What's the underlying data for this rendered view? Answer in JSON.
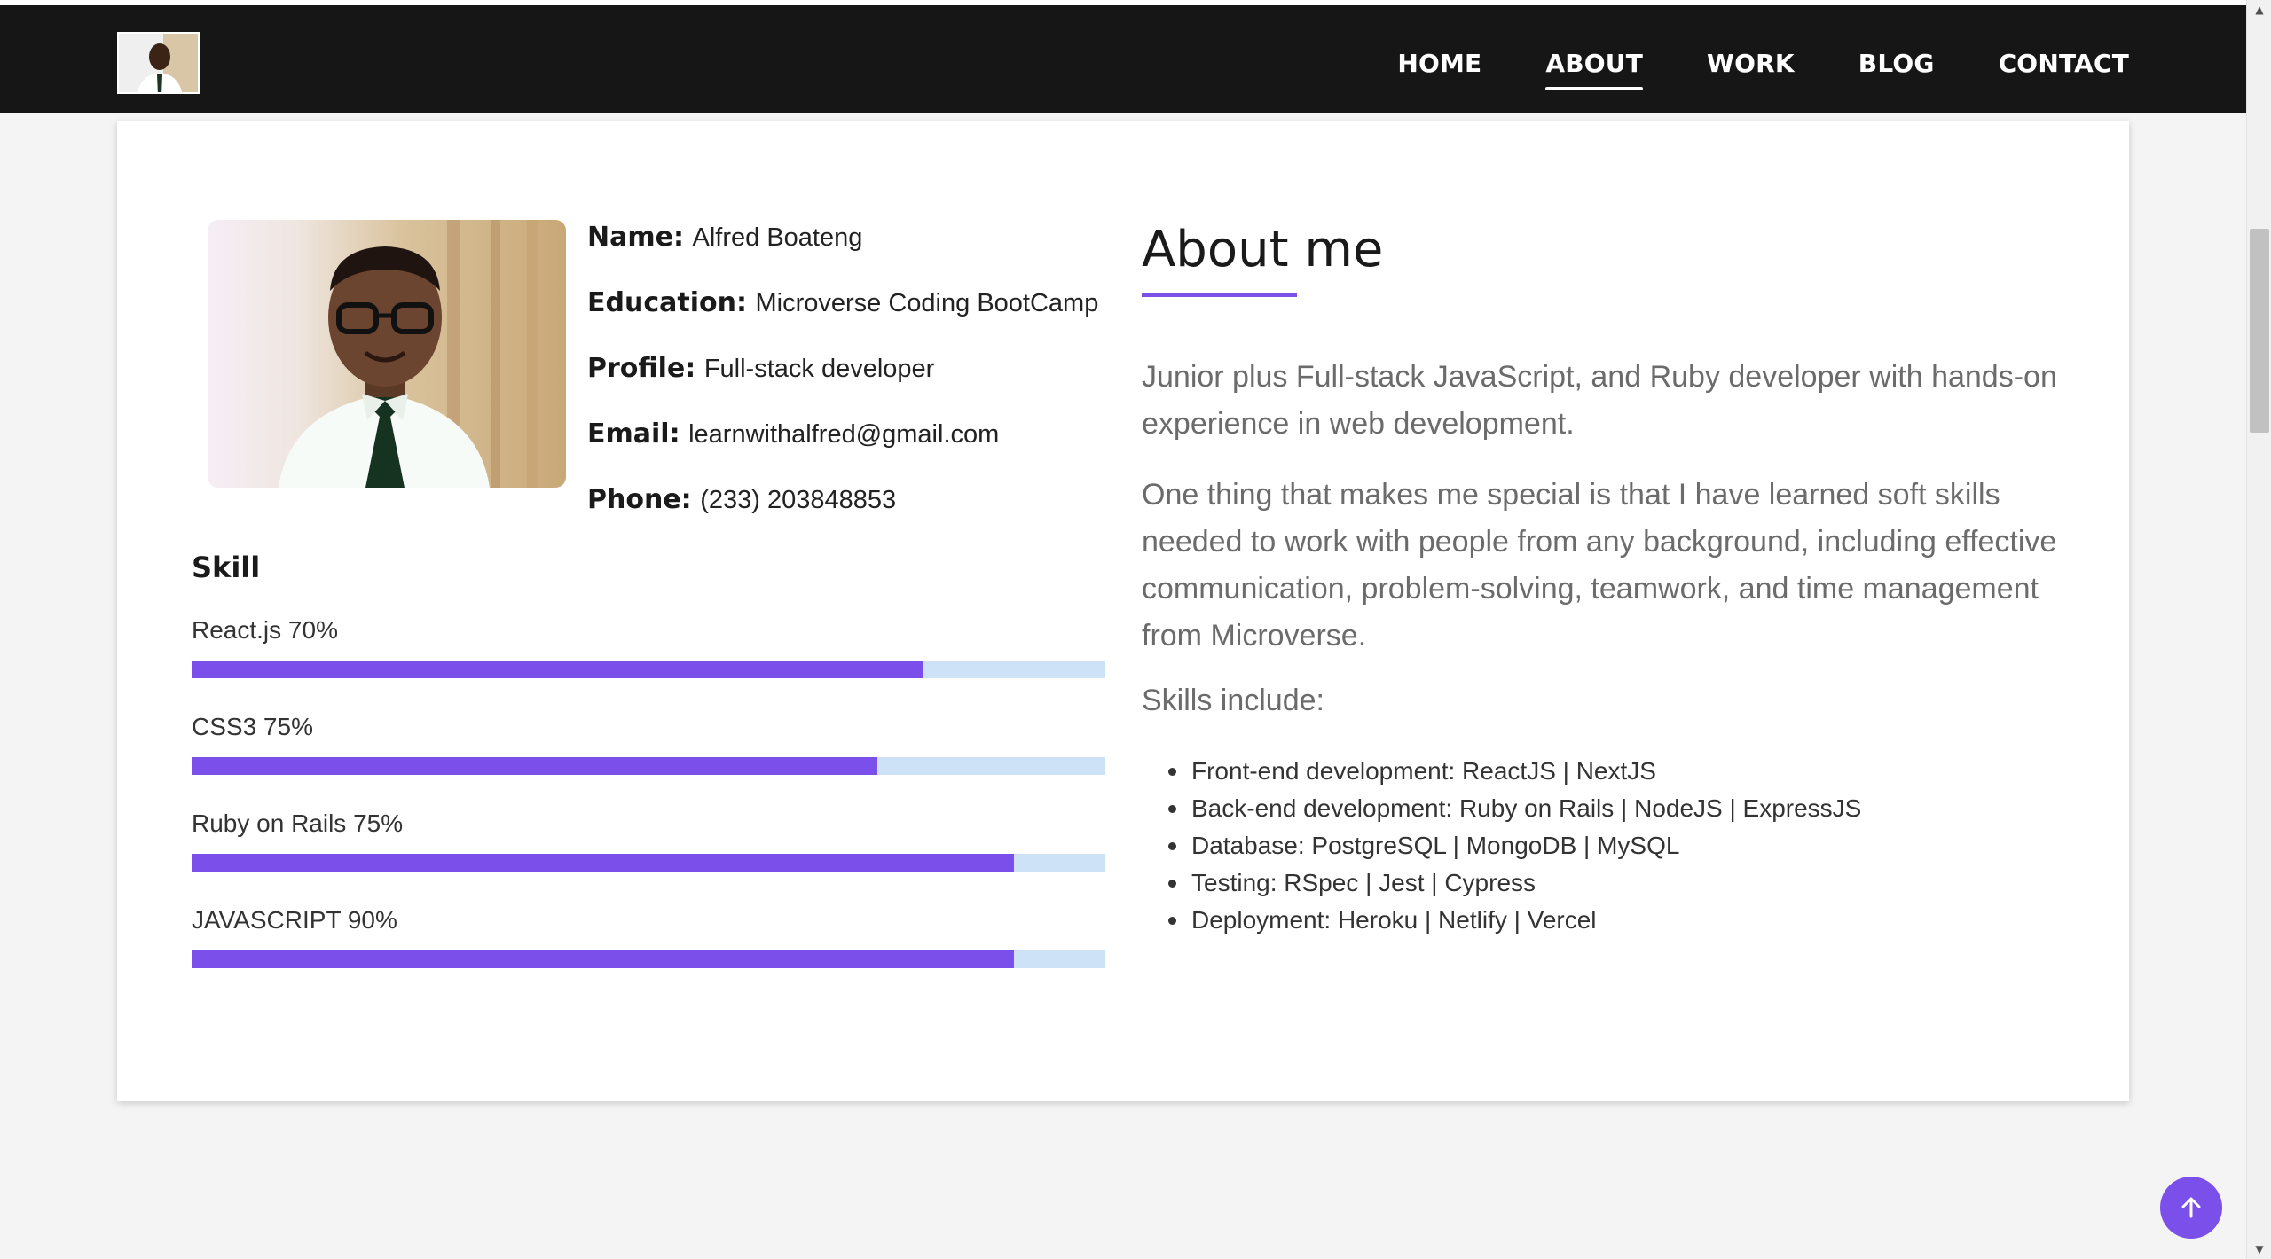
{
  "nav": {
    "items": [
      {
        "label": "HOME",
        "active": false
      },
      {
        "label": "ABOUT",
        "active": true
      },
      {
        "label": "WORK",
        "active": false
      },
      {
        "label": "BLOG",
        "active": false
      },
      {
        "label": "CONTACT",
        "active": false
      }
    ]
  },
  "profile": {
    "name_label": "Name:",
    "name": "Alfred Boateng",
    "education_label": "Education:",
    "education": "Microverse Coding BootCamp",
    "profile_label": "Profile:",
    "profile": "Full-stack developer",
    "email_label": "Email:",
    "email": "learnwithalfred@gmail.com",
    "phone_label": "Phone:",
    "phone": "(233) 203848853"
  },
  "skills": {
    "heading": "Skill",
    "items": [
      {
        "label": "React.js 70%",
        "fill": 0.8
      },
      {
        "label": "CSS3 75%",
        "fill": 0.75
      },
      {
        "label": "Ruby on Rails 75%",
        "fill": 0.9
      },
      {
        "label": "JAVASCRIPT 90%",
        "fill": 0.9
      }
    ]
  },
  "about": {
    "title": "About me",
    "paragraph1": "Junior plus Full-stack JavaScript, and Ruby developer with hands-on experience in web development.",
    "paragraph2": "One thing that makes me special is that I have learned soft skills needed to work with people from any background, including effective communication, problem-solving, teamwork, and time management from Microverse.",
    "skills_include": "Skills include:",
    "list": [
      "Front-end development: ReactJS | NextJS",
      "Back-end development: Ruby on Rails | NodeJS | ExpressJS",
      "Database: PostgreSQL | MongoDB | MySQL",
      "Testing: RSpec | Jest | Cypress",
      "Deployment: Heroku | Netlify | Vercel"
    ]
  },
  "colors": {
    "accent": "#7b4fe9",
    "track": "#cde1f7",
    "nav_bg": "#161616"
  },
  "icons": {
    "back_to_top": "arrow-up-icon"
  }
}
